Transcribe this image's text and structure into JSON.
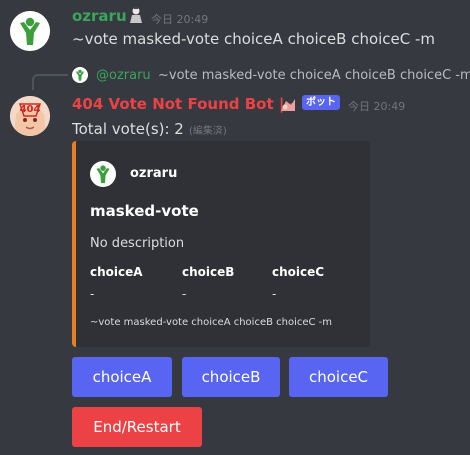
{
  "msg1": {
    "username": "ozraru",
    "timestamp": "今日 20:49",
    "text": "~vote masked-vote choiceA choiceB choiceC -m",
    "colors": {
      "username": "#3ba55d"
    }
  },
  "msg2": {
    "reply": {
      "author": "@ozraru",
      "text": "~vote masked-vote choiceA choiceB choiceC -m"
    },
    "username": "404 Vote Not Found Bot | -",
    "bot_tag": "ボット",
    "timestamp": "今日 20:49",
    "text": "Total vote(s): 2",
    "edited": "(編集済)",
    "colors": {
      "username": "#ed4245"
    },
    "embed": {
      "author": "ozraru",
      "title": "masked-vote",
      "description": "No description",
      "fields": [
        {
          "name": "choiceA",
          "value": "-"
        },
        {
          "name": "choiceB",
          "value": "-"
        },
        {
          "name": "choiceC",
          "value": "-"
        }
      ],
      "footer": "~vote masked-vote choiceA choiceB choiceC -m",
      "colors": {
        "accent": "#e67e22"
      }
    },
    "buttons": {
      "choices": [
        "choiceA",
        "choiceB",
        "choiceC"
      ],
      "end": "End/Restart"
    }
  }
}
